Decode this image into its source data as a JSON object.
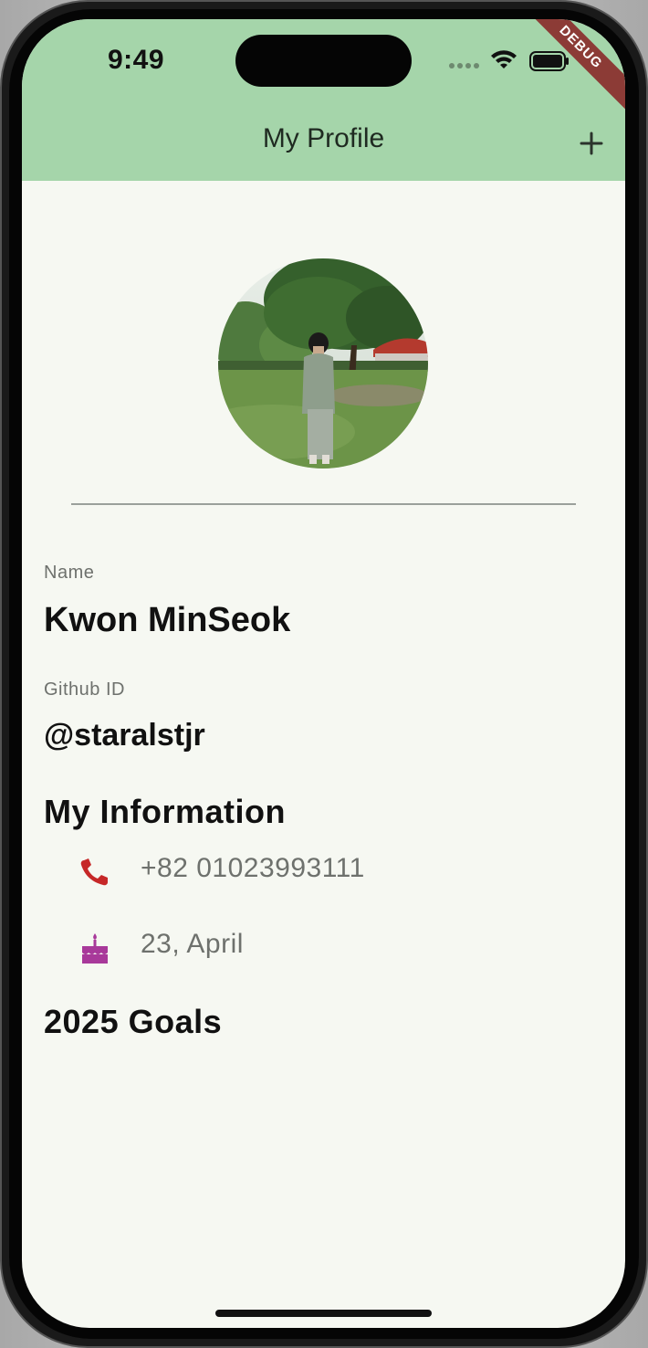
{
  "status_bar": {
    "time": "9:49",
    "debug_label": "DEBUG"
  },
  "appbar": {
    "title": "My Profile",
    "add_icon": "plus-icon",
    "background": "#a5d5aa"
  },
  "profile": {
    "avatar_icon": "profile-photo",
    "name_label": "Name",
    "name_value": "Kwon MinSeok",
    "github_label": "Github ID",
    "github_value": "@staralstjr"
  },
  "info": {
    "title": "My Information",
    "items": [
      {
        "icon": "phone-icon",
        "icon_color": "#c62828",
        "text": "+82 01023993111"
      },
      {
        "icon": "cake-icon",
        "icon_color": "#a8399a",
        "text": "23, April"
      }
    ]
  },
  "goals": {
    "title": "2025 Goals"
  }
}
